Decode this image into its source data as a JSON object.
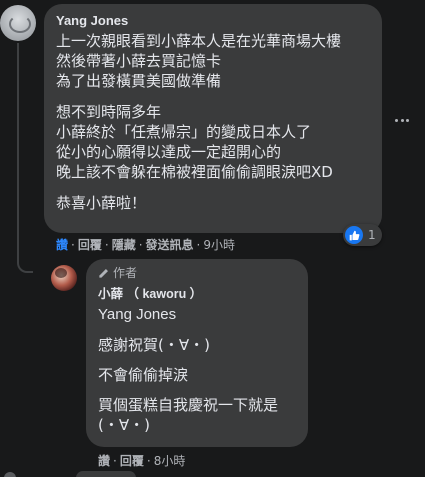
{
  "comment": {
    "author": "Yang Jones",
    "paragraphs": [
      [
        "上一次親眼看到小薛本人是在光華商場大樓",
        "然後帶著小薛去買記憶卡",
        "為了出發橫貫美國做準備"
      ],
      [
        "想不到時隔多年",
        "小薛終於「任煮帰宗」的變成日本人了",
        "從小的心願得以達成一定超開心的",
        "晚上該不會躲在棉被裡面偷偷調眼淚吧XD"
      ],
      [
        "恭喜小薛啦！"
      ]
    ],
    "actions": [
      "讚",
      "回覆",
      "隱藏",
      "發送訊息"
    ],
    "time": "9小時",
    "reaction_count": "1",
    "reaction_icon": "thumbs-up-icon",
    "more_icon": "more-options-icon"
  },
  "reply": {
    "badge_icon": "pencil-icon",
    "badge_label": "作者",
    "author": "小薛 （ kaworu ）",
    "mention": "Yang Jones",
    "paragraphs": [
      [
        "感謝祝賀(・∀・)"
      ],
      [
        "不會偷偷掉淚"
      ],
      [
        "買個蛋糕自我慶祝一下就是",
        "(・∀・)"
      ]
    ],
    "actions": [
      "讚",
      "回覆"
    ],
    "time": "8小時"
  },
  "colors": {
    "background": "#18191a",
    "bubble": "#3a3b3c",
    "text": "#e4e6eb",
    "secondary": "#b0b3b8",
    "like_active": "#2d88ff",
    "reaction_blue": "#1877f2"
  }
}
